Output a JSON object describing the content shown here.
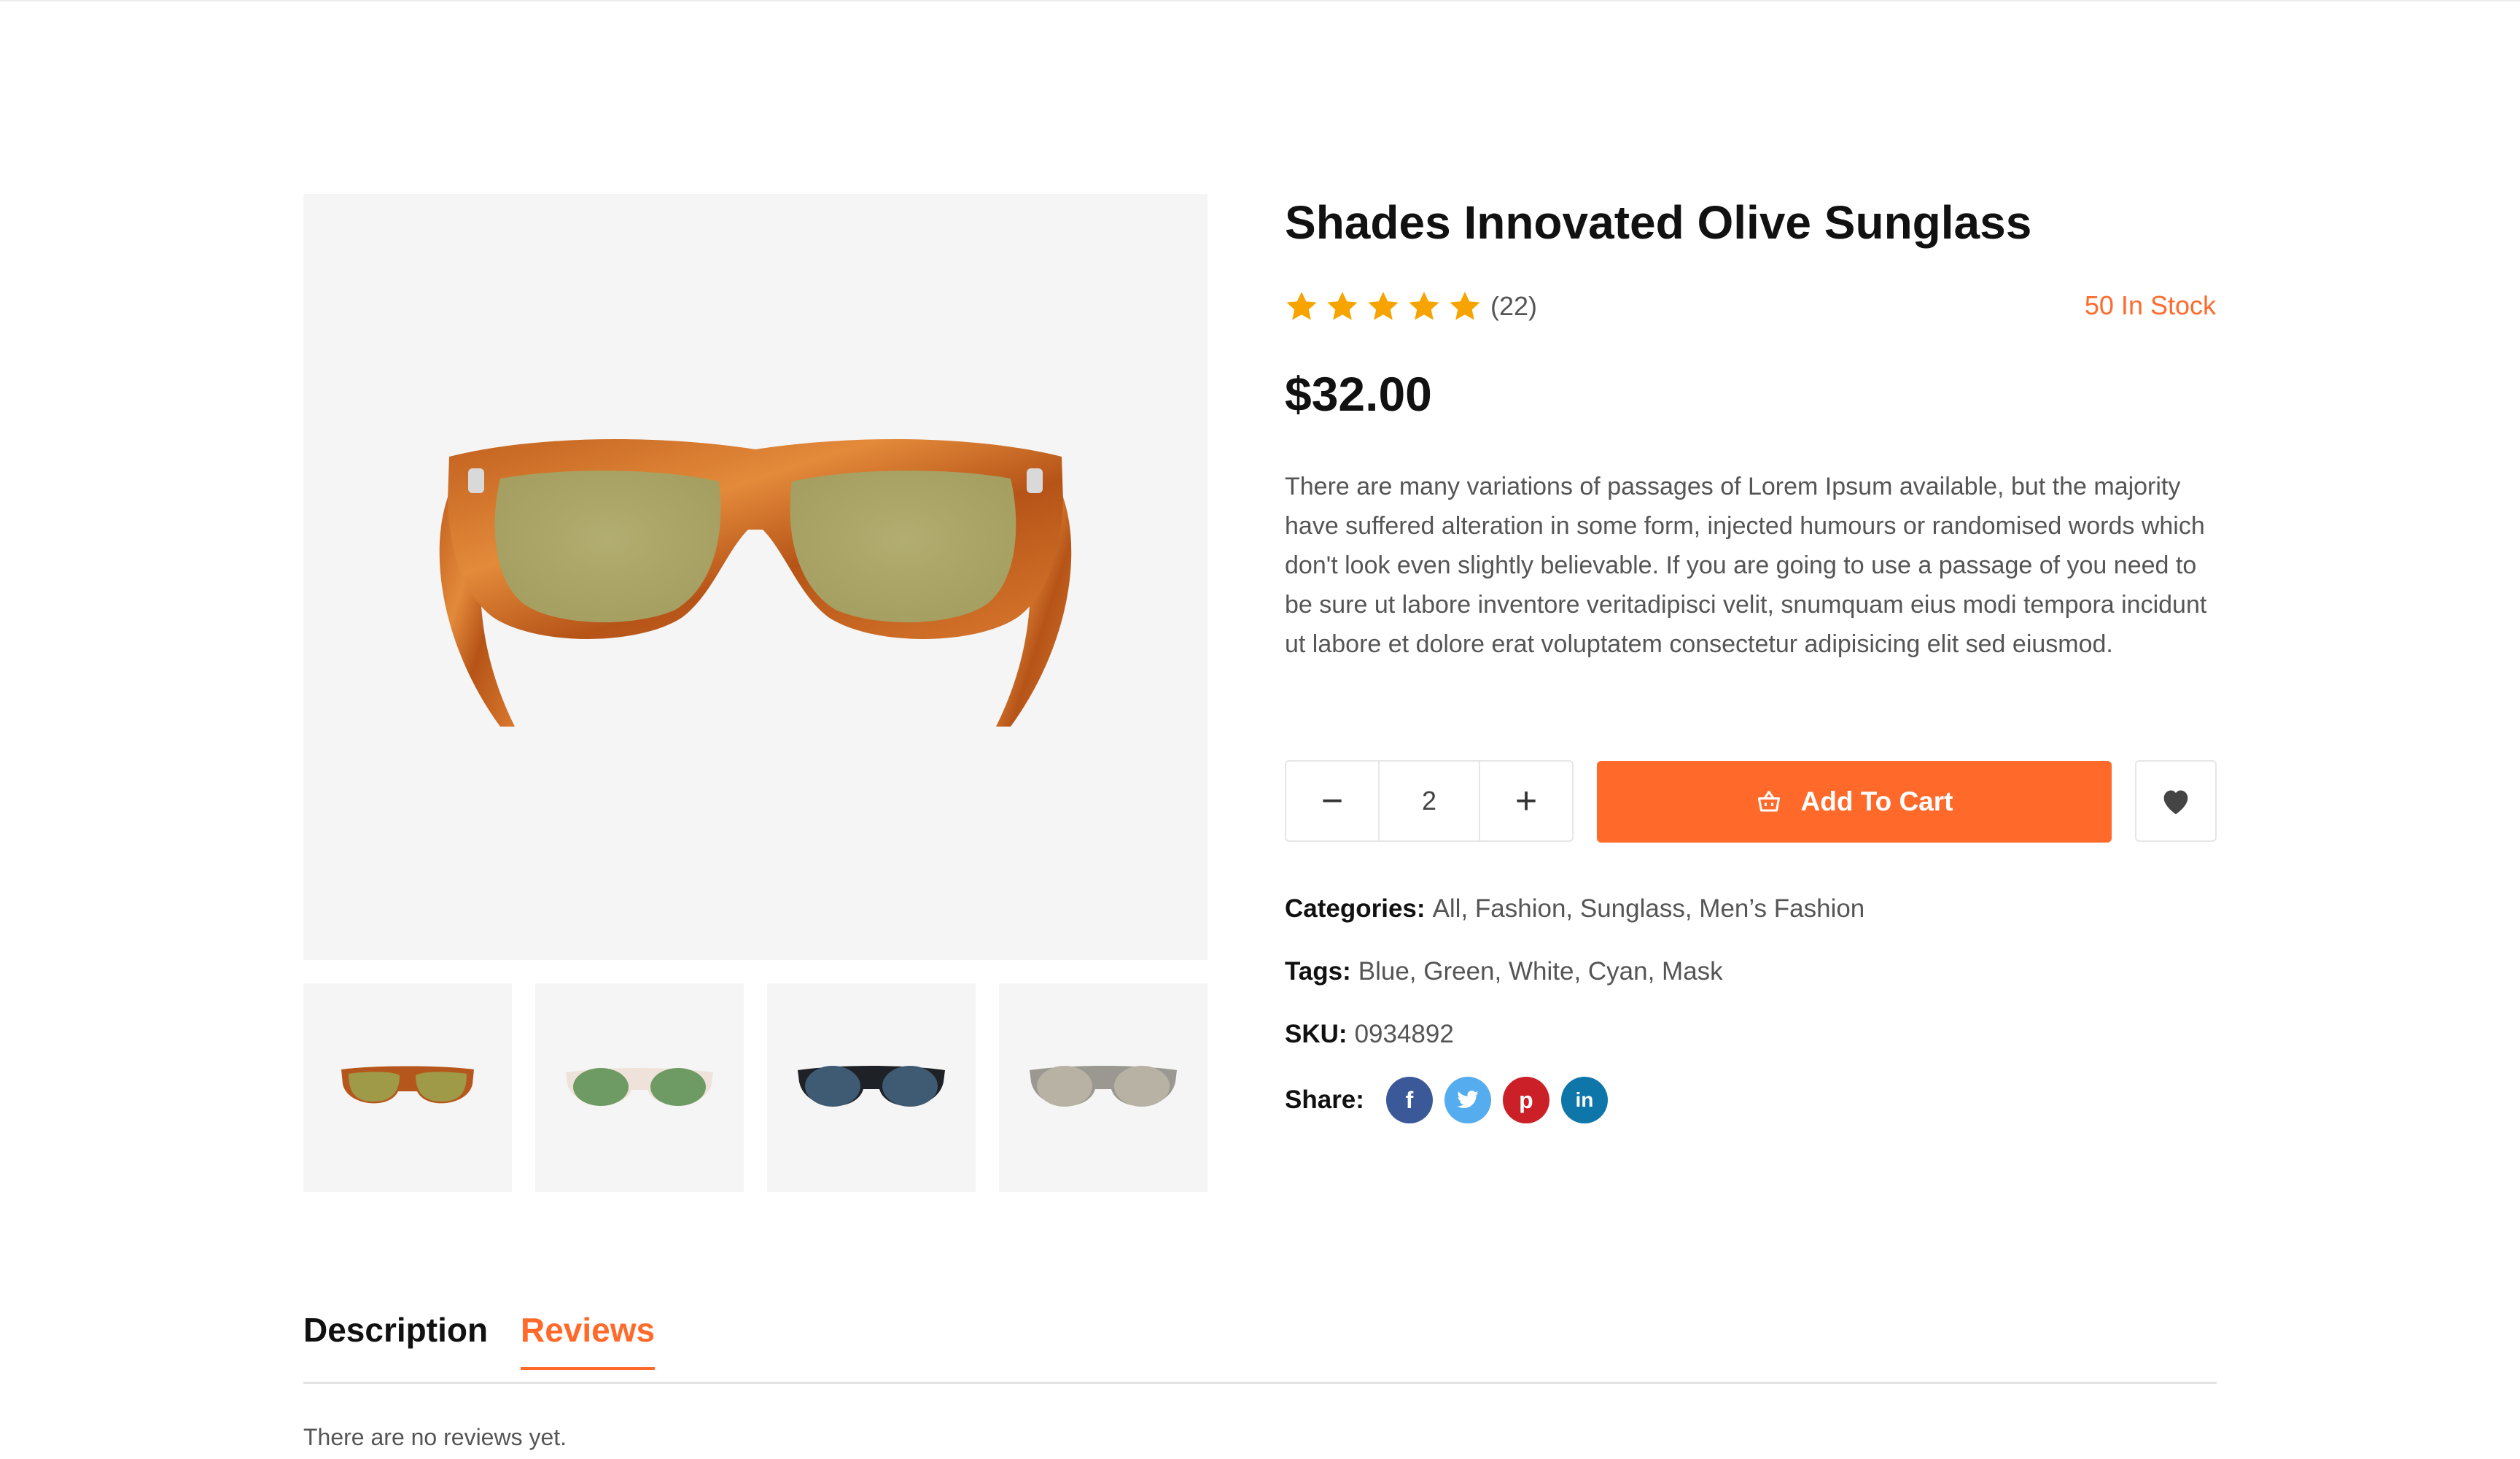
{
  "product": {
    "title": "Shades Innovated Olive Sunglass",
    "rating_stars": 5,
    "rating_count": "(22)",
    "stock": "50 In Stock",
    "price": "$32.00",
    "description": "There are many variations of passages of Lorem Ipsum available, but the majority have suffered alteration in some form, injected humours or randomised words which don't look even slightly believable. If you are going to use a passage of you need to be sure ut labore inventore veritadipisci velit, snumquam eius modi tempora incidunt ut labore et dolore erat voluptatem consectetur adipisicing elit sed eiusmod."
  },
  "gallery": {
    "main_icon": "sunglasses-tortoise-olive",
    "thumbnails": [
      {
        "icon": "sunglasses-tortoise-olive"
      },
      {
        "icon": "sunglasses-clear-green"
      },
      {
        "icon": "sunglasses-black-blue"
      },
      {
        "icon": "sunglasses-silver-grey"
      }
    ]
  },
  "purchase": {
    "quantity": "2",
    "minus_label": "−",
    "plus_label": "+",
    "add_to_cart_label": "Add To Cart",
    "cart_icon": "basket-icon",
    "wishlist_icon": "heart-icon"
  },
  "meta": {
    "categories_label": "Categories:",
    "categories": "All, Fashion, Sunglass, Men’s Fashion",
    "tags_label": "Tags:",
    "tags": "Blue, Green, White, Cyan, Mask",
    "sku_label": "SKU:",
    "sku": "0934892",
    "share_label": "Share:",
    "share": [
      {
        "icon": "facebook-icon",
        "glyph": "f",
        "color": "#3b5998"
      },
      {
        "icon": "twitter-icon",
        "glyph": "t",
        "color": "#55acee"
      },
      {
        "icon": "pinterest-icon",
        "glyph": "p",
        "color": "#cb2027"
      },
      {
        "icon": "linkedin-icon",
        "glyph": "in",
        "color": "#0e76a8"
      }
    ]
  },
  "tabs": [
    {
      "label": "Description",
      "active": false
    },
    {
      "label": "Reviews",
      "active": true
    }
  ],
  "reviews": {
    "empty_text": "There are no reviews yet."
  },
  "colors": {
    "accent": "#ff6a2b",
    "star": "#f7a400",
    "panel": "#f5f5f5"
  }
}
